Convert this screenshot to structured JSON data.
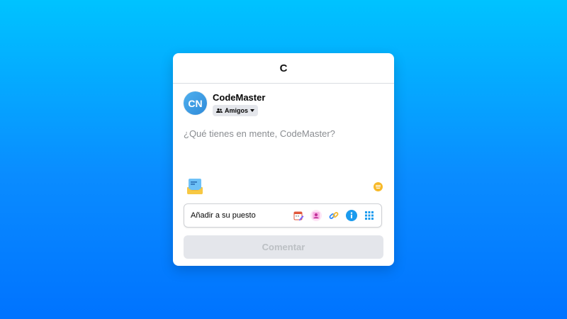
{
  "dialog": {
    "title": "C"
  },
  "user": {
    "initials": "CN",
    "name": "CodeMaster",
    "audience_label": "Amigos"
  },
  "composer": {
    "placeholder": "¿Qué tienes en mente, CodeMaster?"
  },
  "add_to_post": {
    "label": "Añadir a su puesto",
    "icons": [
      "calendar-edit-icon",
      "person-tag-icon",
      "link-icon",
      "info-icon",
      "grid-icon"
    ]
  },
  "submit": {
    "label": "Comentar"
  },
  "colors": {
    "background_top": "#00c3ff",
    "background_bottom": "#0073ff",
    "avatar": "#3d9de6",
    "submit_disabled_bg": "#e4e6eb",
    "submit_disabled_text": "#bcc0c4",
    "emoji": "#f7b928"
  }
}
